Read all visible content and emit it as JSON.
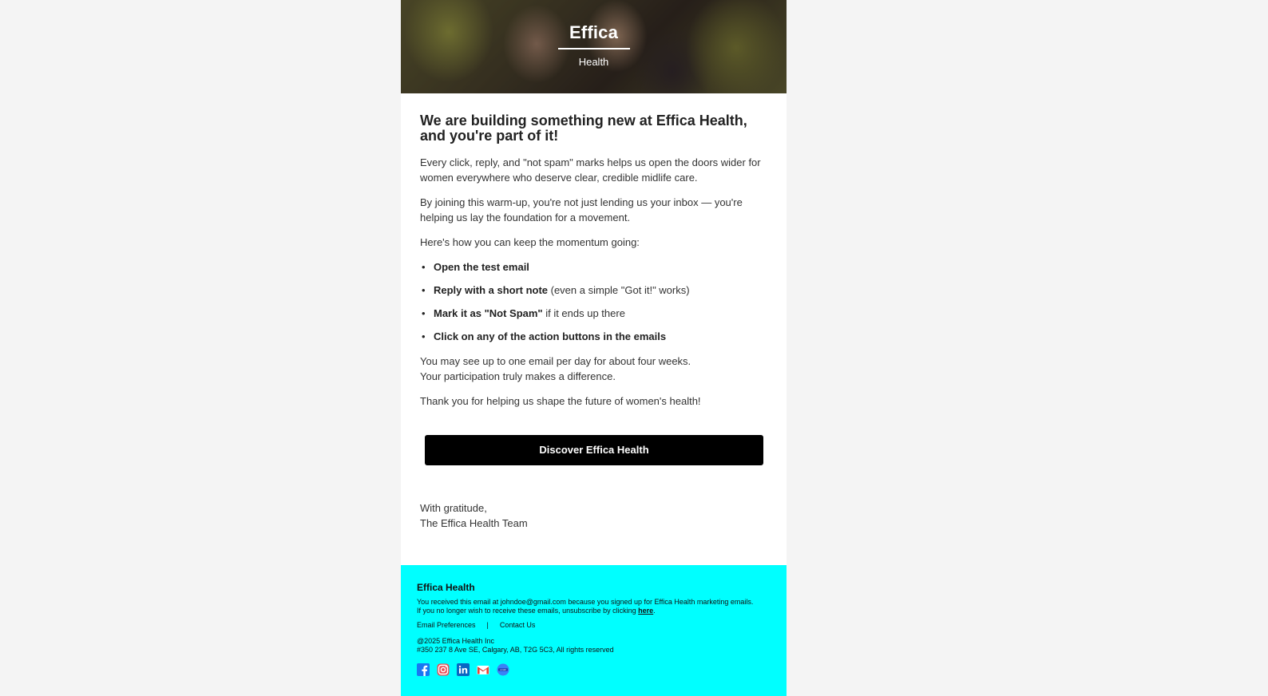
{
  "hero": {
    "brand": "Effica",
    "subtitle": "Health"
  },
  "body": {
    "headline": "We are building something new at Effica Health, and you're part of it!",
    "para1": "Every click, reply, and \"not spam\" marks helps us open the doors wider for women everywhere who deserve clear, credible midlife care.",
    "para2": "By joining this warm-up, you're not just lending us your inbox — you're helping us lay the foundation for a movement.",
    "para3": "Here's how you can keep the momentum going:",
    "actions": [
      {
        "bold": "Open the test email",
        "rest": ""
      },
      {
        "bold": "Reply with a short note",
        "rest": " (even a simple \"Got it!\" works)"
      },
      {
        "bold": "Mark it as \"Not Spam\"",
        "rest": " if it ends up there"
      },
      {
        "bold": "Click on any of the action buttons in the emails",
        "rest": ""
      }
    ],
    "para4_line1": "You may see up to one email per day for about four weeks.",
    "para4_line2": "Your participation truly makes a difference.",
    "para5": "Thank you for helping us shape the future of women's health!",
    "cta_label": "Discover Effica Health",
    "signoff_line1": "With gratitude,",
    "signoff_line2": "The Effica Health Team"
  },
  "footer": {
    "title": "Effica Health",
    "notice_line1": "You received this email at johndoe@gmail.com because you signed up for Effica Health marketing emails.",
    "notice_line2": "If you no longer wish to receive these emails, unsubscribe by clicking ",
    "unsubscribe_link": "here",
    "notice_end": ".",
    "link_preferences": "Email Preferences",
    "separator": "|",
    "link_contact": "Contact Us",
    "copyright": "@2025 Effica Health Inc",
    "address": "#350 237 8 Ave SE, Calgary, AB, T2G 5C3, All rights reserved",
    "social": [
      "facebook-icon",
      "instagram-icon",
      "linkedin-icon",
      "gmail-icon",
      "email-badge-icon"
    ]
  },
  "colors": {
    "page_bg": "#f4f4f4",
    "footer_bg": "#00ffff",
    "cta_bg": "#000000",
    "facebook": "#1877f2",
    "instagram": "#e1306c",
    "linkedin": "#0a66c2"
  }
}
